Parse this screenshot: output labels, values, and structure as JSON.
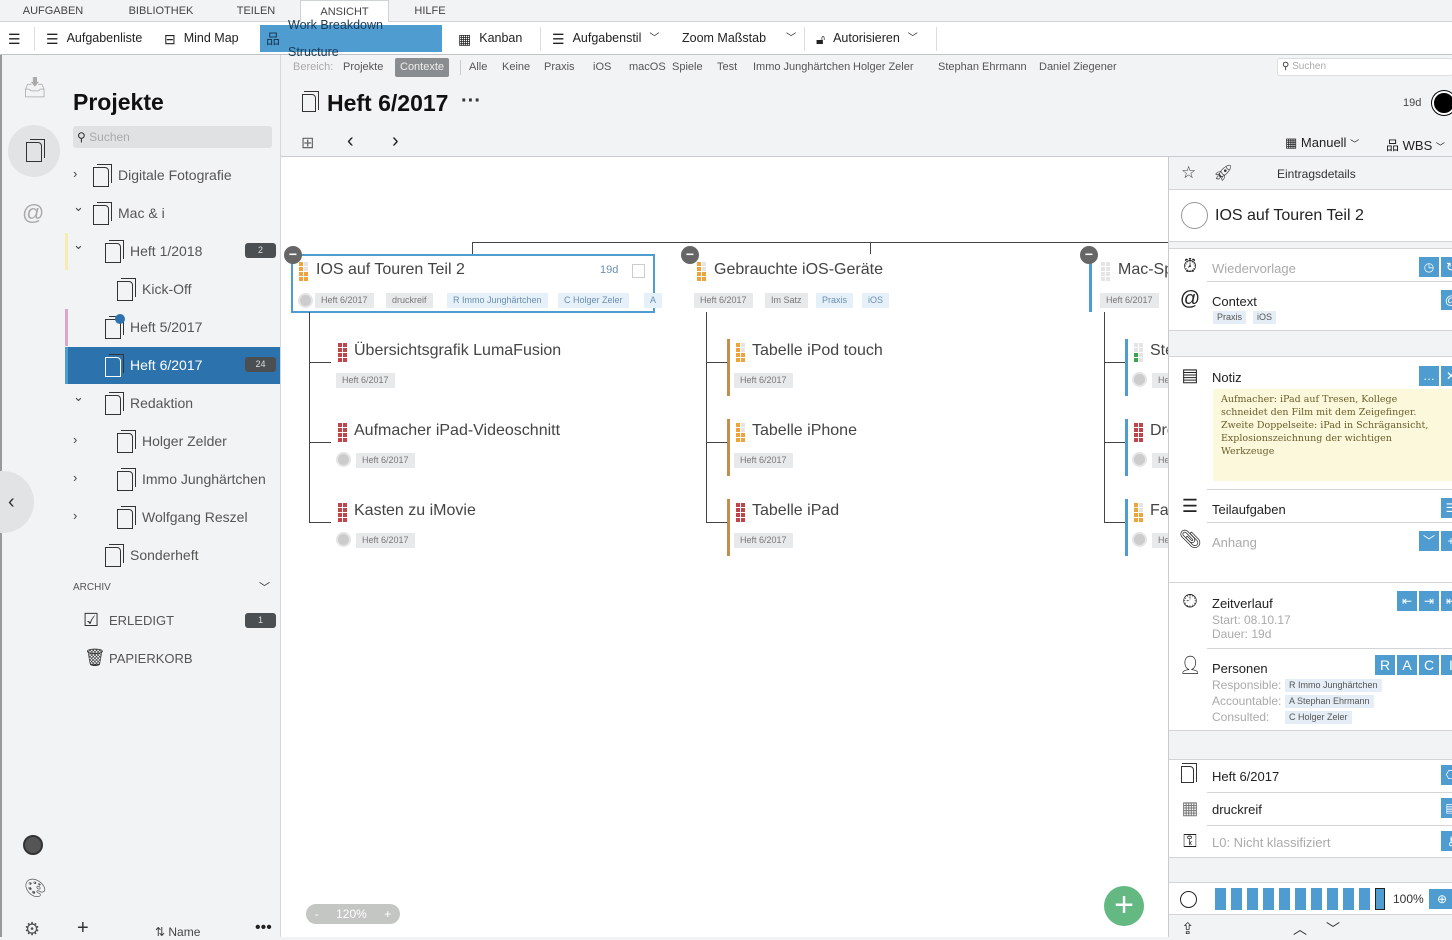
{
  "menu": {
    "tabs": [
      "AUFGABEN",
      "BIBLIOTHEK",
      "TEILEN",
      "ANSICHT",
      "HILFE"
    ],
    "active": "ANSICHT"
  },
  "toolbar": {
    "aufgabenliste": "Aufgabenliste",
    "mindmap": "Mind Map",
    "wbs": "Work Breakdown Structure",
    "kanban": "Kanban",
    "aufgabenstil": "Aufgabenstil",
    "zoom": "Zoom Maßstab",
    "autorisieren": "Autorisieren"
  },
  "sidebar": {
    "title": "Projekte",
    "search_placeholder": "Suchen",
    "items": [
      {
        "label": "Digitale Fotografie",
        "chev": "›",
        "icon": "notebook-icon"
      },
      {
        "label": "Mac & i",
        "chev": "⌄",
        "icon": "notebook-icon"
      },
      {
        "label": "Heft 1/2018",
        "chev": "⌄",
        "badge": "2",
        "stripe": "#f5ecb0"
      },
      {
        "label": "Kick-Off",
        "icon": "image-doc-icon"
      },
      {
        "label": "Heft 5/2017",
        "stripe": "#d9a8c9",
        "check": true
      },
      {
        "label": "Heft 6/2017",
        "badge": "24",
        "selected": true
      },
      {
        "label": "Redaktion",
        "chev": "⌄"
      },
      {
        "label": "Holger Zelder",
        "chev": "›"
      },
      {
        "label": "Immo Junghärtchen",
        "chev": "›"
      },
      {
        "label": "Wolfgang Reszel",
        "chev": "›"
      },
      {
        "label": "Sonderheft"
      }
    ],
    "archive_label": "ARCHIV",
    "erledigt": "ERLEDIGT",
    "erledigt_badge": "1",
    "papierkorb": "PAPIERKORB",
    "sort_label": "⇅ Name"
  },
  "filter": {
    "label": "Bereich:",
    "scope": [
      "Projekte",
      "Contexte"
    ],
    "active": "Contexte",
    "contexts": [
      "Alle",
      "Keine",
      "Praxis",
      "iOS",
      "macOS",
      "Spiele",
      "Test",
      "Immo Junghärtchen",
      "Holger Zeler",
      "Stephan Ehrmann",
      "Daniel Ziegener"
    ],
    "search_placeholder": "Suchen"
  },
  "header": {
    "title": "Heft 6/2017",
    "duration": "19d",
    "sort": "Manuell",
    "view": "WBS"
  },
  "colors": {
    "accent": "#4f9dd0",
    "selected": "#2c72ad",
    "orange": "#eea43a",
    "red": "#c0444a",
    "green": "#3aa64a",
    "add": "#63b981",
    "note": "#fbf8dc"
  },
  "wbs": {
    "nodes": [
      {
        "title": "IOS auf Touren Teil 2",
        "duration": "19d",
        "tags": [
          "Heft 6/2017",
          "druckreif",
          "R Immo Junghärtchen",
          "C Holger Zeler",
          "A"
        ],
        "children": [
          {
            "title": "Übersichtsgrafik LumaFusion",
            "tags": [
              "Heft 6/2017"
            ],
            "prio": "red"
          },
          {
            "title": "Aufmacher iPad-Videoschnitt",
            "tags": [
              "Heft 6/2017"
            ],
            "prio": "red"
          },
          {
            "title": "Kasten zu iMovie",
            "tags": [
              "Heft 6/2017"
            ],
            "prio": "red"
          }
        ]
      },
      {
        "title": "Gebrauchte iOS-Geräte",
        "tags": [
          "Heft 6/2017",
          "Im Satz",
          "Praxis",
          "iOS"
        ],
        "children": [
          {
            "title": "Tabelle iPod touch",
            "tags": [
              "Heft 6/2017"
            ],
            "prio": "orange"
          },
          {
            "title": "Tabelle iPhone",
            "tags": [
              "Heft 6/2017"
            ],
            "prio": "orange"
          },
          {
            "title": "Tabelle iPad",
            "tags": [
              "Heft 6/2017"
            ],
            "prio": "red"
          }
        ]
      },
      {
        "title": "Mac-Spi",
        "tags": [
          "Heft 6/2017"
        ],
        "children": [
          {
            "title": "Ste",
            "tags": [
              "He"
            ],
            "prio": "green"
          },
          {
            "title": "Dre",
            "tags": [
              "He"
            ],
            "prio": "red"
          },
          {
            "title": "Fal",
            "tags": [
              "He"
            ],
            "prio": "orange"
          }
        ]
      }
    ],
    "zoom": "120%"
  },
  "details": {
    "header": "Eintragsdetails",
    "title": "IOS auf Touren Teil 2",
    "wiedervorlage": "Wiedervorlage",
    "context": "Context",
    "context_tags": [
      "Praxis",
      "iOS"
    ],
    "notiz": "Notiz",
    "note_text": "Aufmacher: iPad auf Tresen, Kollege schneidet den Film mit dem Zeigefinger. Zweite Doppelseite: iPad in Schrägansicht, Explosionszeichnung der wichtigen Werkzeuge",
    "teilaufgaben": "Teilaufgaben",
    "anhang": "Anhang",
    "zeitverlauf": "Zeitverlauf",
    "start": "Start: 08.10.17",
    "dauer": "Dauer: 19d",
    "personen": "Personen",
    "raci": [
      "R",
      "A",
      "C",
      "I"
    ],
    "responsible_label": "Responsible:",
    "responsible": "R Immo Junghärtchen",
    "accountable_label": "Accountable:",
    "accountable": "A Stephan Ehrmann",
    "consulted_label": "Consulted:",
    "consulted": "C Holger Zeler",
    "project": "Heft 6/2017",
    "status": "druckreif",
    "classification": "L0: Nicht klassifiziert",
    "progress_percent": 100,
    "progress_label": "100%"
  }
}
